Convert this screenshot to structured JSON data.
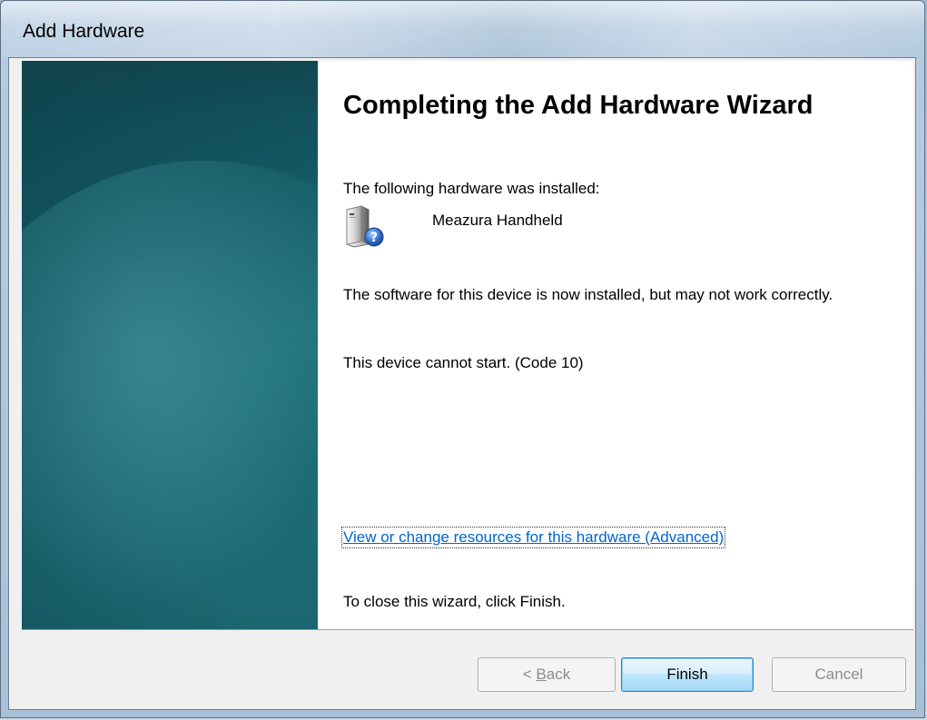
{
  "window": {
    "title": "Add Hardware"
  },
  "content": {
    "heading": "Completing the Add Hardware Wizard",
    "installed_label": "The following hardware was installed:",
    "device_name": "Meazura Handheld",
    "device_icon": "hardware-unknown-icon",
    "software_message": "The software for this device is now installed, but may not work correctly.",
    "status_message": "This device cannot start. (Code 10)",
    "resources_link": "View or change resources for this hardware (Advanced)",
    "close_message": "To close this wizard, click Finish."
  },
  "buttons": {
    "back_prefix": "< ",
    "back_accel": "B",
    "back_rest": "ack",
    "finish": "Finish",
    "cancel": "Cancel"
  },
  "colors": {
    "banner": "#1f6f78",
    "link": "#0066cc",
    "default_button_border": "#3c7fb1"
  }
}
